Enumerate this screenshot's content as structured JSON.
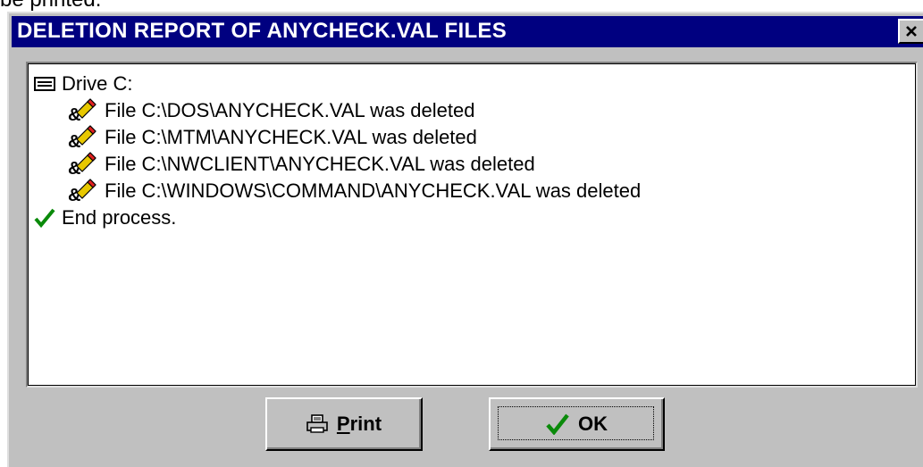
{
  "background_text": "be printed.",
  "dialog": {
    "title": "DELETION REPORT OF ANYCHECK.VAL FILES",
    "close_symbol": "×"
  },
  "report": {
    "drive_line": "Drive C:",
    "deleted_files": [
      "File C:\\DOS\\ANYCHECK.VAL was deleted",
      "File C:\\MTM\\ANYCHECK.VAL was deleted",
      "File C:\\NWCLIENT\\ANYCHECK.VAL was deleted",
      "File C:\\WINDOWS\\COMMAND\\ANYCHECK.VAL was deleted"
    ],
    "end_line": "End process."
  },
  "buttons": {
    "print_accel": "P",
    "print_rest": "rint",
    "ok_label": "OK"
  },
  "icons": {
    "drive": "drive-icon",
    "eraser": "eraser-icon",
    "check": "checkmark-icon",
    "printer": "printer-icon",
    "close": "close-icon"
  },
  "colors": {
    "titlebar": "#000080",
    "check_green": "#0a8a0a",
    "eraser_red": "#e02020",
    "eraser_yellow": "#e8c800"
  }
}
